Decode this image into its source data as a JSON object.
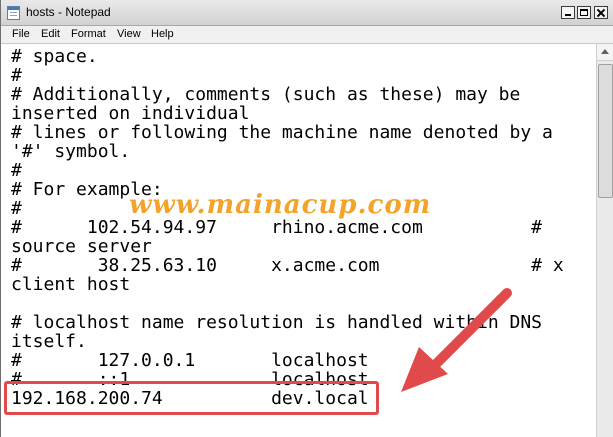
{
  "window": {
    "title": "hosts - Notepad"
  },
  "menu": [
    "File",
    "Edit",
    "Format",
    "View",
    "Help"
  ],
  "editor": {
    "lines": [
      "# space.",
      "#",
      "# Additionally, comments (such as these) may be",
      "inserted on individual",
      "# lines or following the machine name denoted by a",
      "'#' symbol.",
      "#",
      "# For example:",
      "#",
      "#      102.54.94.97     rhino.acme.com          #",
      "source server",
      "#       38.25.63.10     x.acme.com              # x",
      "client host",
      "",
      "# localhost name resolution is handled within DNS",
      "itself.",
      "#       127.0.0.1       localhost",
      "#       ::1             localhost",
      "192.168.200.74          dev.local"
    ]
  },
  "annotation": {
    "watermark_text": "www.mainacup.com",
    "highlight_color": "#e04a4a",
    "arrow_color": "#e04a4a"
  }
}
